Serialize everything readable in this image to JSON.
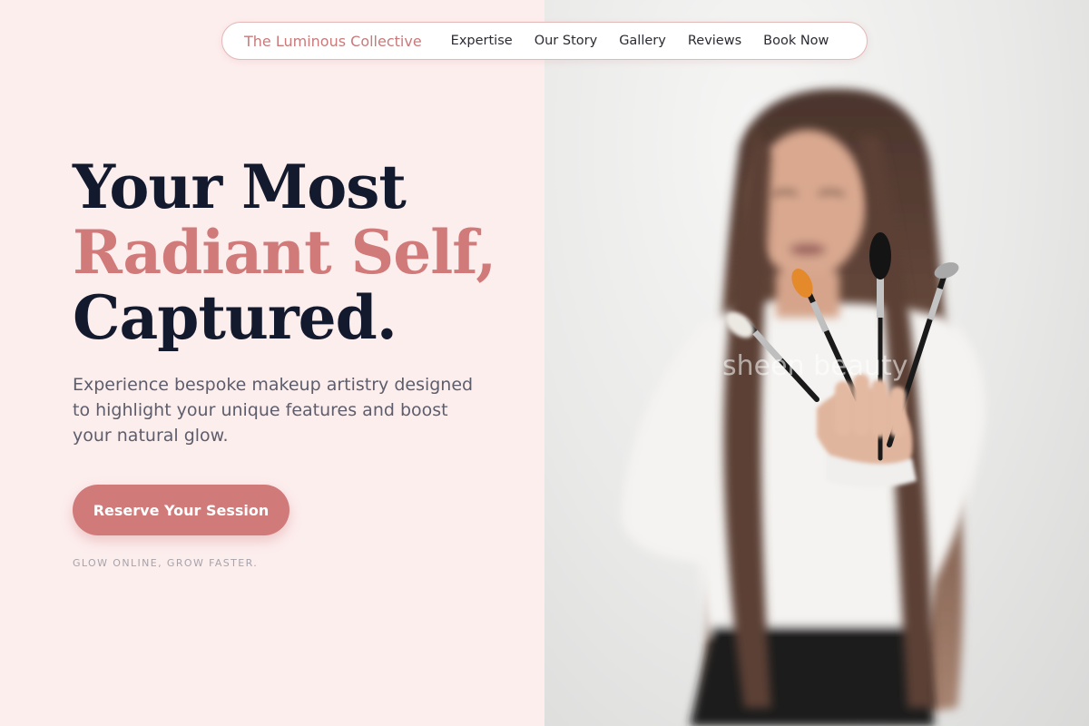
{
  "nav": {
    "brand": "The Luminous Collective",
    "links": [
      "Expertise",
      "Our Story",
      "Gallery",
      "Reviews",
      "Book Now"
    ]
  },
  "hero": {
    "headline_line1": "Your Most",
    "headline_line2": "Radiant Self,",
    "headline_line3": "Captured.",
    "subtext": "Experience bespoke makeup artistry designed to highlight your unique features and boost your natural glow.",
    "cta_label": "Reserve Your Session",
    "tagline": "GLOW ONLINE, GROW FASTER.",
    "image_watermark": "sheen beauty"
  },
  "colors": {
    "background": "#fdeeee",
    "accent": "#d07a7a",
    "heading": "#141a2e",
    "body_text": "#5d5d6b"
  },
  "icons": [
    "makeup-brush-icon"
  ]
}
